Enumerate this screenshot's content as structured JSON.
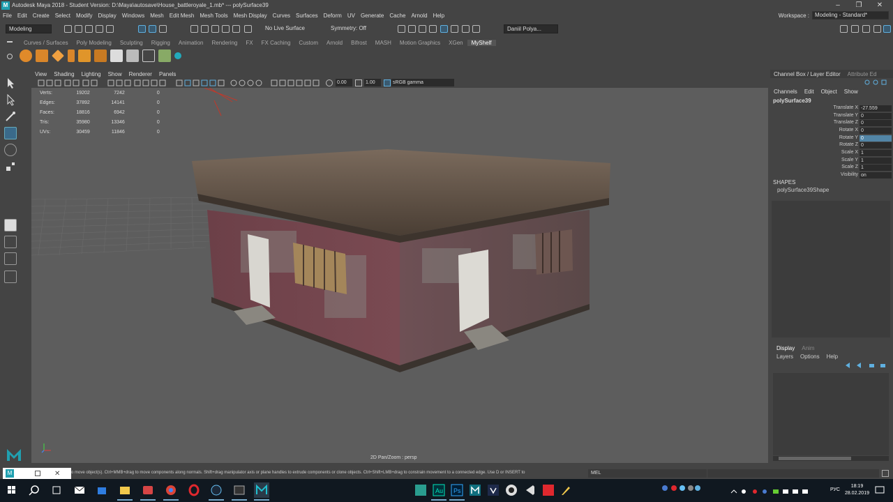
{
  "titlebar": {
    "title": "Autodesk Maya 2018 - Student Version: D:\\Maya\\autosave\\House_battleroyale_1.mb*  ---  polySurface39",
    "logo_letter": "M"
  },
  "menubar": {
    "items": [
      "File",
      "Edit",
      "Create",
      "Select",
      "Modify",
      "Display",
      "Windows",
      "Mesh",
      "Edit Mesh",
      "Mesh Tools",
      "Mesh Display",
      "Curves",
      "Surfaces",
      "Deform",
      "UV",
      "Generate",
      "Cache",
      "Arnold",
      "Help"
    ],
    "workspace_label": "Workspace :",
    "workspace_value": "Modeling - Standard*"
  },
  "statusline": {
    "menu_set": "Modeling",
    "live_surface": "No Live Surface",
    "symmetry": "Symmetry: Off",
    "user": "Daniil Polya..."
  },
  "shelf": {
    "tabs": [
      "Curves / Surfaces",
      "Poly Modeling",
      "Sculpting",
      "Rigging",
      "Animation",
      "Rendering",
      "FX",
      "FX Caching",
      "Custom",
      "Arnold",
      "Bifrost",
      "MASH",
      "Motion Graphics",
      "XGen",
      "MyShelf"
    ],
    "active_tab": "MyShelf"
  },
  "viewport": {
    "menus": [
      "View",
      "Shading",
      "Lighting",
      "Show",
      "Renderer",
      "Panels"
    ],
    "exposure": "0.00",
    "gamma": "1.00",
    "color_space": "sRGB gamma",
    "hud": [
      {
        "label": "Verts:",
        "a": "19202",
        "b": "7242",
        "c": "0"
      },
      {
        "label": "Edges:",
        "a": "37892",
        "b": "14141",
        "c": "0"
      },
      {
        "label": "Faces:",
        "a": "18816",
        "b": "6942",
        "c": "0"
      },
      {
        "label": "Tris:",
        "a": "35980",
        "b": "13346",
        "c": "0"
      },
      {
        "label": "UVs:",
        "a": "30459",
        "b": "11846",
        "c": "0"
      }
    ],
    "camera_label": "2D Pan/Zoom : persp"
  },
  "channelbox": {
    "tabs": [
      "Channel Box / Layer Editor",
      "Attribute Ed"
    ],
    "menus": [
      "Channels",
      "Edit",
      "Object",
      "Show"
    ],
    "object": "polySurface39",
    "attributes": [
      {
        "label": "Translate X",
        "value": "-27.559"
      },
      {
        "label": "Translate Y",
        "value": "0"
      },
      {
        "label": "Translate Z",
        "value": "0"
      },
      {
        "label": "Rotate X",
        "value": "0"
      },
      {
        "label": "Rotate Y",
        "value": "0"
      },
      {
        "label": "Rotate Z",
        "value": "0"
      },
      {
        "label": "Scale X",
        "value": "1"
      },
      {
        "label": "Scale Y",
        "value": "1"
      },
      {
        "label": "Scale Z",
        "value": "1"
      },
      {
        "label": "Visibility",
        "value": "on"
      }
    ],
    "highlighted_attribute": "Rotate Y",
    "shapes_heading": "SHAPES",
    "shape_name": "polySurface39Shape"
  },
  "layereditor": {
    "tabs": [
      "Display",
      "Anim"
    ],
    "active_tab": "Display",
    "menus": [
      "Layers",
      "Options",
      "Help"
    ]
  },
  "helpline": {
    "text": "o move object(s). Ctrl+MMB+drag to move components along normals. Shift+drag manipulator axis or plane handles to extrude components or clone objects. Ctrl+Shift+LMB+drag to constrain movement to a connected edge. Use D or INSERT to",
    "script_type": "MEL"
  },
  "taskbar": {
    "lang": "РУС",
    "time": "18:19",
    "date": "28.02.2019",
    "apps": [
      "start-icon",
      "search-icon",
      "task-view-icon",
      "mail-icon",
      "store-icon",
      "explorer-icon",
      "photo-app-icon",
      "chrome-icon",
      "opera-icon",
      "steam-icon",
      "terminal-icon",
      "maya-icon",
      "substance-icon",
      "audition-icon",
      "photoshop-icon",
      "maya-icon-2",
      "visual-studio-icon",
      "obs-icon",
      "vscode-icon",
      "acrobat-icon",
      "pencil-app-icon"
    ]
  },
  "colors": {
    "ui_bg": "#444444",
    "viewport_bg": "#5d5d5d",
    "accent_blue": "#5285a6",
    "maya_teal": "#20a0b0",
    "taskbar_bg": "#101820"
  }
}
